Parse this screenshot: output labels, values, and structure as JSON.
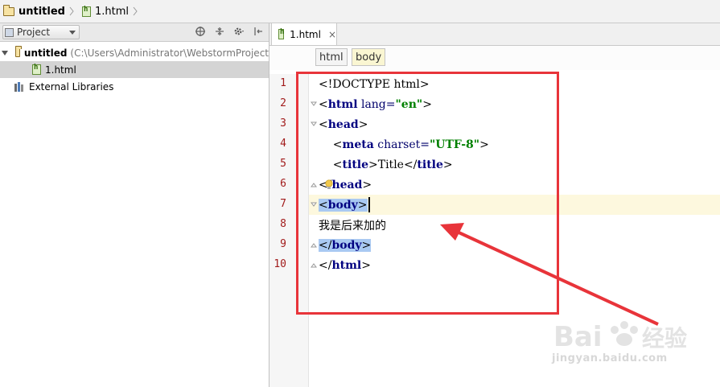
{
  "navbar": {
    "project_name": "untitled",
    "file_name": "1.html"
  },
  "project_panel": {
    "view_label": "Project",
    "tree": {
      "root_label": "untitled",
      "root_path": "(C:\\Users\\Administrator\\WebstormProject",
      "file_label": "1.html",
      "ext_libs_label": "External Libraries"
    }
  },
  "editor": {
    "tab_label": "1.html",
    "breadcrumbs": [
      "html",
      "body"
    ],
    "line_numbers": [
      "1",
      "2",
      "3",
      "4",
      "5",
      "6",
      "7",
      "8",
      "9",
      "10"
    ],
    "lines": [
      {
        "n": "1",
        "parts": [
          {
            "t": "<!DOCTYPE html>",
            "c": "plain"
          }
        ]
      },
      {
        "n": "2",
        "parts": [
          {
            "t": "<",
            "c": "plain"
          },
          {
            "t": "html",
            "c": "kw"
          },
          {
            "t": " lang=",
            "c": "attr"
          },
          {
            "t": "\"en\"",
            "c": "str"
          },
          {
            "t": ">",
            "c": "plain"
          }
        ]
      },
      {
        "n": "3",
        "parts": [
          {
            "t": "<",
            "c": "plain"
          },
          {
            "t": "head",
            "c": "kw"
          },
          {
            "t": ">",
            "c": "plain"
          }
        ]
      },
      {
        "n": "4",
        "parts": [
          {
            "t": "    <",
            "c": "plain"
          },
          {
            "t": "meta",
            "c": "kw"
          },
          {
            "t": " charset=",
            "c": "attr"
          },
          {
            "t": "\"UTF-8\"",
            "c": "str"
          },
          {
            "t": ">",
            "c": "plain"
          }
        ]
      },
      {
        "n": "5",
        "parts": [
          {
            "t": "    <",
            "c": "plain"
          },
          {
            "t": "title",
            "c": "kw"
          },
          {
            "t": ">Title</",
            "c": "plain"
          },
          {
            "t": "title",
            "c": "kw"
          },
          {
            "t": ">",
            "c": "plain"
          }
        ]
      },
      {
        "n": "6",
        "parts": [
          {
            "t": "</",
            "c": "plain"
          },
          {
            "t": "head",
            "c": "kw"
          },
          {
            "t": ">",
            "c": "plain"
          }
        ]
      },
      {
        "n": "7",
        "parts": [
          {
            "t": "<",
            "c": "hl"
          },
          {
            "t": "body",
            "c": "hlkw"
          },
          {
            "t": ">",
            "c": "hl"
          }
        ]
      },
      {
        "n": "8",
        "parts": [
          {
            "t": "我是后来加的",
            "c": "plain"
          }
        ]
      },
      {
        "n": "9",
        "parts": [
          {
            "t": "</",
            "c": "hl"
          },
          {
            "t": "body",
            "c": "hlkw"
          },
          {
            "t": ">",
            "c": "hl"
          }
        ]
      },
      {
        "n": "10",
        "parts": [
          {
            "t": "</",
            "c": "plain"
          },
          {
            "t": "html",
            "c": "kw"
          },
          {
            "t": ">",
            "c": "plain"
          }
        ]
      }
    ]
  },
  "watermark": {
    "brand": "Baidu经验",
    "url": "jingyan.baidu.com"
  },
  "colors": {
    "annotation_red": "#e8343a",
    "keyword": "#000080",
    "string": "#008000",
    "line_number": "#a21c1c",
    "selection": "#a9c9f2",
    "caret_row": "#fdf8de"
  }
}
